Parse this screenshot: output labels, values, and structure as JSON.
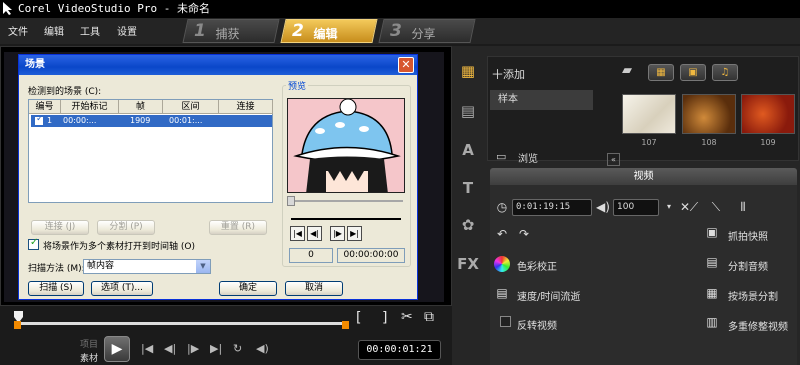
{
  "window": {
    "title": "Corel VideoStudio Pro - 未命名"
  },
  "menu": [
    "文件",
    "编辑",
    "工具",
    "设置"
  ],
  "steps": [
    {
      "num": "1",
      "label": "捕获",
      "active": false
    },
    {
      "num": "2",
      "label": "编辑",
      "active": true
    },
    {
      "num": "3",
      "label": "分享",
      "active": false
    }
  ],
  "dialog": {
    "title": "场景",
    "detected_label": "检测到的场景 (C):",
    "columns": [
      "编号",
      "开始标记",
      "帧",
      "区间",
      "连接"
    ],
    "rows": [
      {
        "index": "1",
        "start": "00:00:...",
        "frames": "1909",
        "duration": "00:01:...",
        "link": "",
        "checked": true
      }
    ],
    "buttons": {
      "join": "连接 (J)",
      "split": "分割 (P)",
      "reset": "重置 (R)"
    },
    "multi_clip_label": "将场景作为多个素材打开到时间轴 (O)",
    "scan_method_label": "扫描方法 (M):",
    "scan_method_value": "帧内容",
    "scan_button": "扫描 (S)",
    "options_button": "选项 (T)...",
    "ok_button": "确定",
    "cancel_button": "取消",
    "preview": {
      "label": "预览",
      "frame": "0",
      "timecode": "00:00:00:00"
    }
  },
  "player": {
    "project_label": "项目",
    "clip_label": "素材",
    "timecode": "00:00:01:21"
  },
  "library": {
    "add_label": "添加",
    "folder": "样本",
    "browse_label": "浏览",
    "thumbnails": [
      {
        "num": "107",
        "color": "#e9e2d2"
      },
      {
        "num": "108",
        "color": "#6e3a10"
      },
      {
        "num": "109",
        "color": "#b32a14"
      }
    ]
  },
  "options": {
    "tab_label": "视频",
    "duration": "0:01:19:15",
    "volume": "100",
    "color_correction": "色彩校正",
    "speed": "速度/时间流逝",
    "reverse": "反转视频",
    "snapshot": "抓拍快照",
    "split_audio": "分割音频",
    "split_by_scene": "按场景分割",
    "multi_trim": "多重修整视频"
  }
}
